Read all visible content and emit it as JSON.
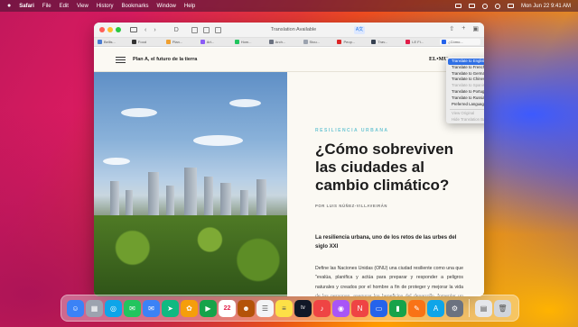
{
  "menubar": {
    "items": [
      "Safari",
      "File",
      "Edit",
      "View",
      "History",
      "Bookmarks",
      "Window",
      "Help"
    ],
    "clock": "Mon Jun 22 9:41 AM"
  },
  "browser": {
    "address_text": "Translation Available",
    "translate_icon": "translate-icon",
    "tabs": [
      {
        "label": "Bellis...",
        "color": "#4a7bd0"
      },
      {
        "label": "Food",
        "color": "#333333"
      },
      {
        "label": "Plan...",
        "color": "#f0a030"
      },
      {
        "label": "Art...",
        "color": "#8b5cf6"
      },
      {
        "label": "Hom...",
        "color": "#22c55e"
      },
      {
        "label": "Arch...",
        "color": "#6b7280"
      },
      {
        "label": "Stou...",
        "color": "#9ca3af"
      },
      {
        "label": "Peop...",
        "color": "#dc2626"
      },
      {
        "label": "Trav...",
        "color": "#374151"
      },
      {
        "label": "LE Fi...",
        "color": "#e11d48"
      }
    ],
    "active_tab": {
      "label": "¿Cómo...",
      "color": "#2563eb"
    }
  },
  "translate_menu": {
    "items": [
      {
        "label": "Translate to English",
        "state": "selected"
      },
      {
        "label": "Translate to French",
        "state": "normal"
      },
      {
        "label": "Translate to German",
        "state": "normal"
      },
      {
        "label": "Translate to Chinese, Simplified",
        "state": "normal"
      },
      {
        "label": "Translate to Spanish",
        "state": "disabled"
      },
      {
        "label": "Translate to Portuguese",
        "state": "normal"
      },
      {
        "label": "Translate to Russian",
        "state": "normal"
      },
      {
        "label": "Preferred Languages...",
        "state": "normal"
      },
      {
        "label": "View Original",
        "state": "disabled",
        "sep_before": true
      },
      {
        "label": "Hide Translation Banner",
        "state": "disabled"
      }
    ]
  },
  "site": {
    "title": "Plan A, el futuro de la tierra",
    "logo": "EL•MUNDO"
  },
  "article": {
    "kicker": "RESILIENCIA URBANA",
    "headline": "¿Cómo sobreviven las ciudades al cambio climático?",
    "byline": "POR LUIS NÚÑEZ-VILLAVEIRÁN",
    "lead": "La resiliencia urbana, uno de los retos de las urbes del siglo XXI",
    "body": "Define las Naciones Unidas (ONU) una ciudad resiliente como una que \"evalúa, planifica y actúa para preparar y responder a peligros naturales y creados por el hombre a fin de proteger y mejorar la vida de las personas, asegurar los beneficios del desarrollo, fomentar un entorno de inversión e impulsar un cambio positivo\". Estos desafíos, los tenemos a día de hoy muy"
  },
  "dock": {
    "apps": [
      {
        "name": "finder",
        "color": "#3b82f6"
      },
      {
        "name": "launchpad",
        "color": "#9ca3af"
      },
      {
        "name": "safari",
        "color": "#0ea5e9"
      },
      {
        "name": "messages",
        "color": "#22c55e"
      },
      {
        "name": "mail",
        "color": "#3b82f6"
      },
      {
        "name": "maps",
        "color": "#10b981"
      },
      {
        "name": "photos",
        "color": "#f59e0b"
      },
      {
        "name": "facetime",
        "color": "#16a34a"
      },
      {
        "name": "calendar",
        "color": "#ffffff"
      },
      {
        "name": "contacts",
        "color": "#b45309"
      },
      {
        "name": "reminders",
        "color": "#f3f4f6"
      },
      {
        "name": "notes",
        "color": "#fde047"
      },
      {
        "name": "tv",
        "color": "#111827"
      },
      {
        "name": "music",
        "color": "#ef4444"
      },
      {
        "name": "podcasts",
        "color": "#a855f7"
      },
      {
        "name": "news",
        "color": "#ef4444"
      },
      {
        "name": "keynote",
        "color": "#2563eb"
      },
      {
        "name": "numbers",
        "color": "#16a34a"
      },
      {
        "name": "pages",
        "color": "#f97316"
      },
      {
        "name": "app-store",
        "color": "#0ea5e9"
      },
      {
        "name": "system-preferences",
        "color": "#6b7280"
      }
    ],
    "extras": [
      {
        "name": "downloads",
        "color": "#e5e7eb"
      },
      {
        "name": "trash",
        "color": "#d1d5db"
      }
    ],
    "calendar_day": "22",
    "tv_label": "tv"
  }
}
